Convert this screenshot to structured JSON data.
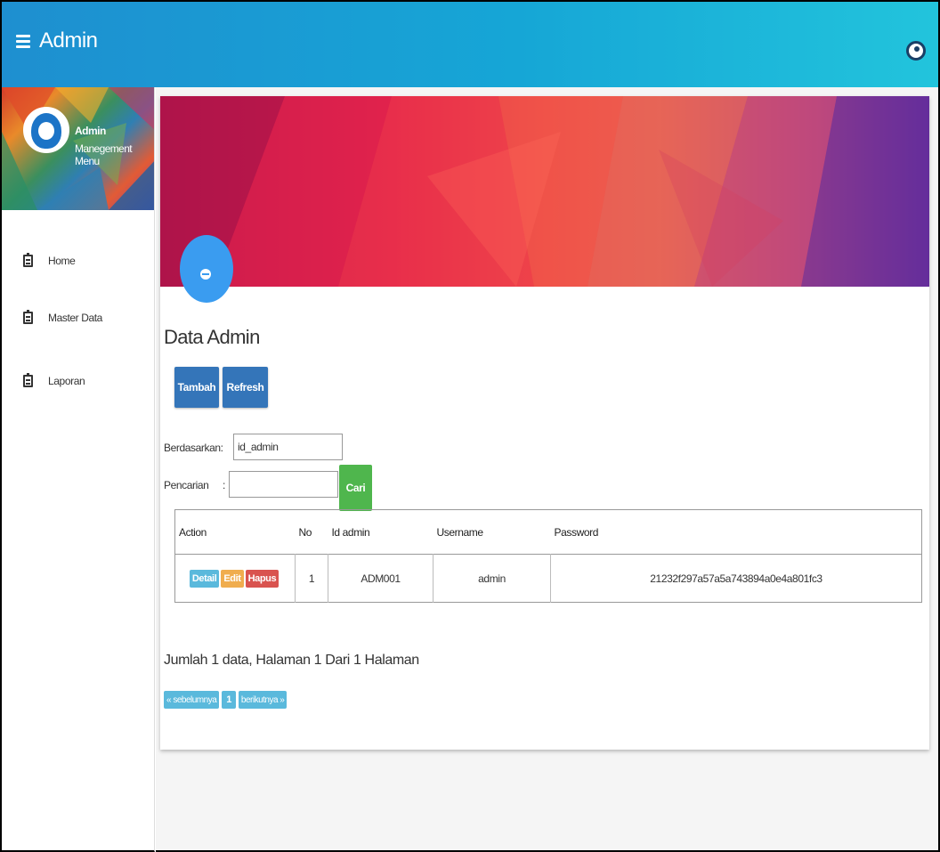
{
  "header": {
    "app_title": "Admin",
    "menu_icon": "hamburger-icon",
    "user_icon": "user-circle-icon"
  },
  "sidebar": {
    "profile_name": "Admin",
    "profile_subtitle": "Manegement Menu",
    "items": [
      {
        "label": "Home",
        "icon": "clipboard-icon"
      },
      {
        "label": "Master Data",
        "icon": "clipboard-icon"
      },
      {
        "label": "Laporan",
        "icon": "clipboard-icon"
      }
    ]
  },
  "main": {
    "page_title": "Data Admin",
    "buttons": {
      "add": "Tambah",
      "refresh": "Refresh",
      "search": "Cari"
    },
    "filter": {
      "by_label": "Berdasarkan:",
      "by_value": "id_admin",
      "search_label": "Pencarian",
      "search_sep": ":",
      "search_value": ""
    },
    "table": {
      "headers": [
        "Action",
        "No",
        "Id admin",
        "Username",
        "Password"
      ],
      "rows": [
        {
          "no": "1",
          "id_admin": "ADM001",
          "username": "admin",
          "password": "21232f297a57a5a743894a0e4a801fc3",
          "actions": [
            "Detail",
            "Edit",
            "Hapus"
          ]
        }
      ]
    },
    "summary": "Jumlah 1 data, Halaman 1 Dari 1 Halaman",
    "pager": {
      "prev": "« sebelumnya",
      "current": "1",
      "next": "berikutnya »"
    }
  },
  "colors": {
    "topbar": "#1e8fd0",
    "primary": "#3475b9",
    "success": "#4fb64d",
    "info": "#5ab9dc",
    "warning": "#f0ad4e",
    "danger": "#d9534f",
    "fab": "#3a9cf0"
  }
}
